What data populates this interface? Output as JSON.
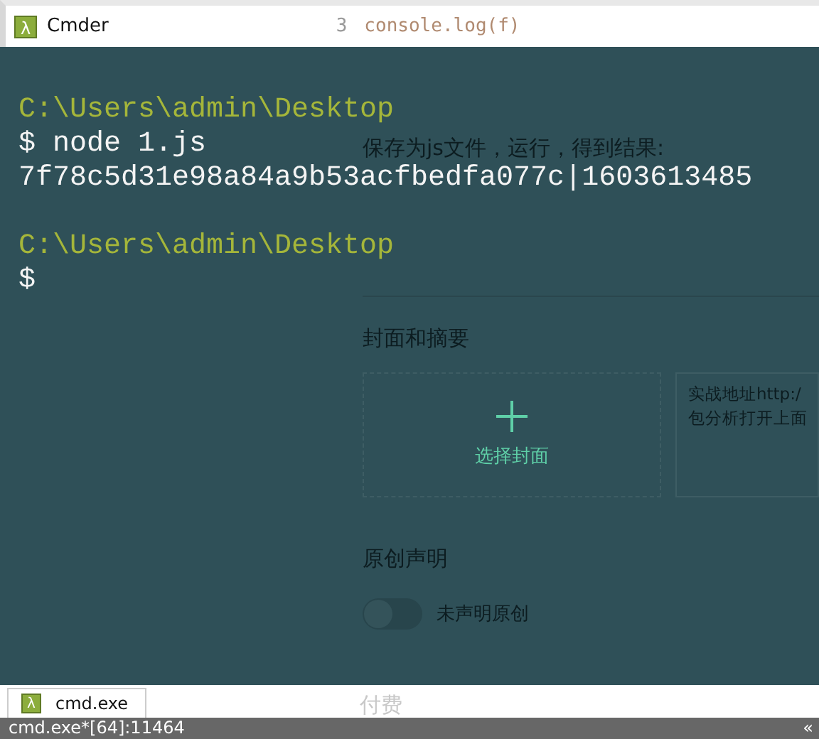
{
  "window": {
    "logo": "λ",
    "title": "Cmder"
  },
  "background_page": {
    "code_line_number": "3",
    "code_line": "console.log(f)",
    "instruction": "保存为js文件，运行，得到结果:",
    "cover_section_title": "封面和摘要",
    "cover_button": "选择封面",
    "summary_lines": [
      "实战地址http:/",
      "包分析打开上面"
    ],
    "original_section_title": "原创声明",
    "original_toggle": {
      "on": false,
      "label": "未声明原创"
    },
    "paid_section_title": "付费"
  },
  "terminal": {
    "lines": [
      {
        "kind": "path",
        "text": "C:\\Users\\admin\\Desktop"
      },
      {
        "kind": "text",
        "text": "$ node 1.js"
      },
      {
        "kind": "text",
        "text": "7f78c5d31e98a84a9b53acfbedfa077c|1603613485"
      },
      {
        "kind": "blank"
      },
      {
        "kind": "path",
        "text": "C:\\Users\\admin\\Desktop"
      },
      {
        "kind": "text",
        "text": "$"
      }
    ]
  },
  "tabs": [
    {
      "icon": "λ",
      "label": "cmd.exe",
      "selected": true
    }
  ],
  "status_bar": {
    "text": "cmd.exe*[64]:11464",
    "collapse": "«"
  }
}
